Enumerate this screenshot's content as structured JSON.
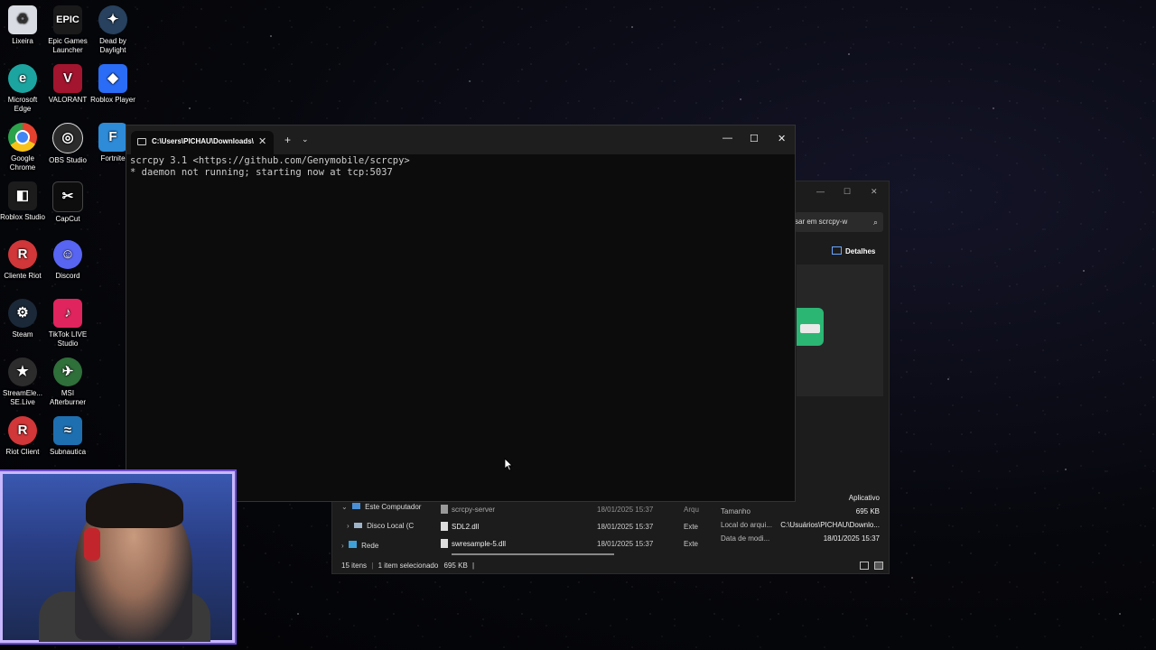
{
  "desktop_icons": [
    {
      "label": "Lixeira",
      "icon": "recycle-bin-icon",
      "color": "#d9dde3"
    },
    {
      "label": "Epic Games Launcher",
      "icon": "epic-games-icon",
      "color": "#1a1a1a"
    },
    {
      "label": "Dead by Daylight",
      "icon": "dead-by-daylight-icon",
      "color": "#27415e"
    },
    {
      "label": "Microsoft Edge",
      "icon": "edge-icon",
      "color": "#1ca5a0"
    },
    {
      "label": "VALORANT",
      "icon": "valorant-icon",
      "color": "#a3152e"
    },
    {
      "label": "Roblox Player",
      "icon": "roblox-icon",
      "color": "#2a6cf5"
    },
    {
      "label": "Google Chrome",
      "icon": "chrome-icon",
      "color": "#e5412e"
    },
    {
      "label": "OBS Studio",
      "icon": "obs-icon",
      "color": "#2b2b2b"
    },
    {
      "label": "Fortnite",
      "icon": "fortnite-icon",
      "color": "#2d8bd8"
    },
    {
      "label": "Roblox Studio",
      "icon": "roblox-studio-icon",
      "color": "#1c1c1c"
    },
    {
      "label": "CapCut",
      "icon": "capcut-icon",
      "color": "#0d0d0d"
    },
    {
      "label": "Cliente Riot",
      "icon": "riot-icon",
      "color": "#d13639"
    },
    {
      "label": "Discord",
      "icon": "discord-icon",
      "color": "#5865f2"
    },
    {
      "label": "Steam",
      "icon": "steam-icon",
      "color": "#1b2838"
    },
    {
      "label": "TikTok LIVE Studio",
      "icon": "tiktok-icon",
      "color": "#e0245e"
    },
    {
      "label": "StreamEle... SE.Live",
      "icon": "streamelements-icon",
      "color": "#2c2c2c"
    },
    {
      "label": "MSI Afterburner",
      "icon": "msi-afterburner-icon",
      "color": "#2f6f3a"
    },
    {
      "label": "Riot Client",
      "icon": "riot-client-icon",
      "color": "#d13639"
    },
    {
      "label": "Subnautica",
      "icon": "subnautica-icon",
      "color": "#1e6fb0"
    }
  ],
  "terminal": {
    "tab_title": "C:\\Users\\PICHAU\\Downloads\\",
    "new_tab": "+",
    "dropdown": "⌄",
    "minimize": "—",
    "maximize": "☐",
    "close": "✕",
    "lines": [
      "scrcpy 3.1 <https://github.com/Genymobile/scrcpy>",
      "* daemon not running; starting now at tcp:5037"
    ]
  },
  "explorer": {
    "search_placeholder": "sar em scrcpy-w",
    "details_label": "Detalhes",
    "tree": [
      {
        "label": "Este Computador",
        "expanded": true
      },
      {
        "label": "Disco Local (C",
        "expanded": false
      },
      {
        "label": "Rede",
        "expanded": false
      }
    ],
    "files": [
      {
        "name": "scrcpy-server",
        "date": "18/01/2025 15:37",
        "type": "Arqu"
      },
      {
        "name": "SDL2.dll",
        "date": "18/01/2025 15:37",
        "type": "Exte"
      },
      {
        "name": "swresample-5.dll",
        "date": "18/01/2025 15:37",
        "type": "Exte"
      }
    ],
    "properties": {
      "type_value": "Aplicativo",
      "size_label": "Tamanho",
      "size_value": "695 KB",
      "location_label": "Local do arqui...",
      "location_value": "C:\\Usuários\\PICHAU\\Downlo...",
      "modified_label": "Data de modi...",
      "modified_value": "18/01/2025 15:37"
    },
    "status": {
      "count": "15 itens",
      "selected": "1 item selecionado",
      "size": "695 KB"
    }
  }
}
